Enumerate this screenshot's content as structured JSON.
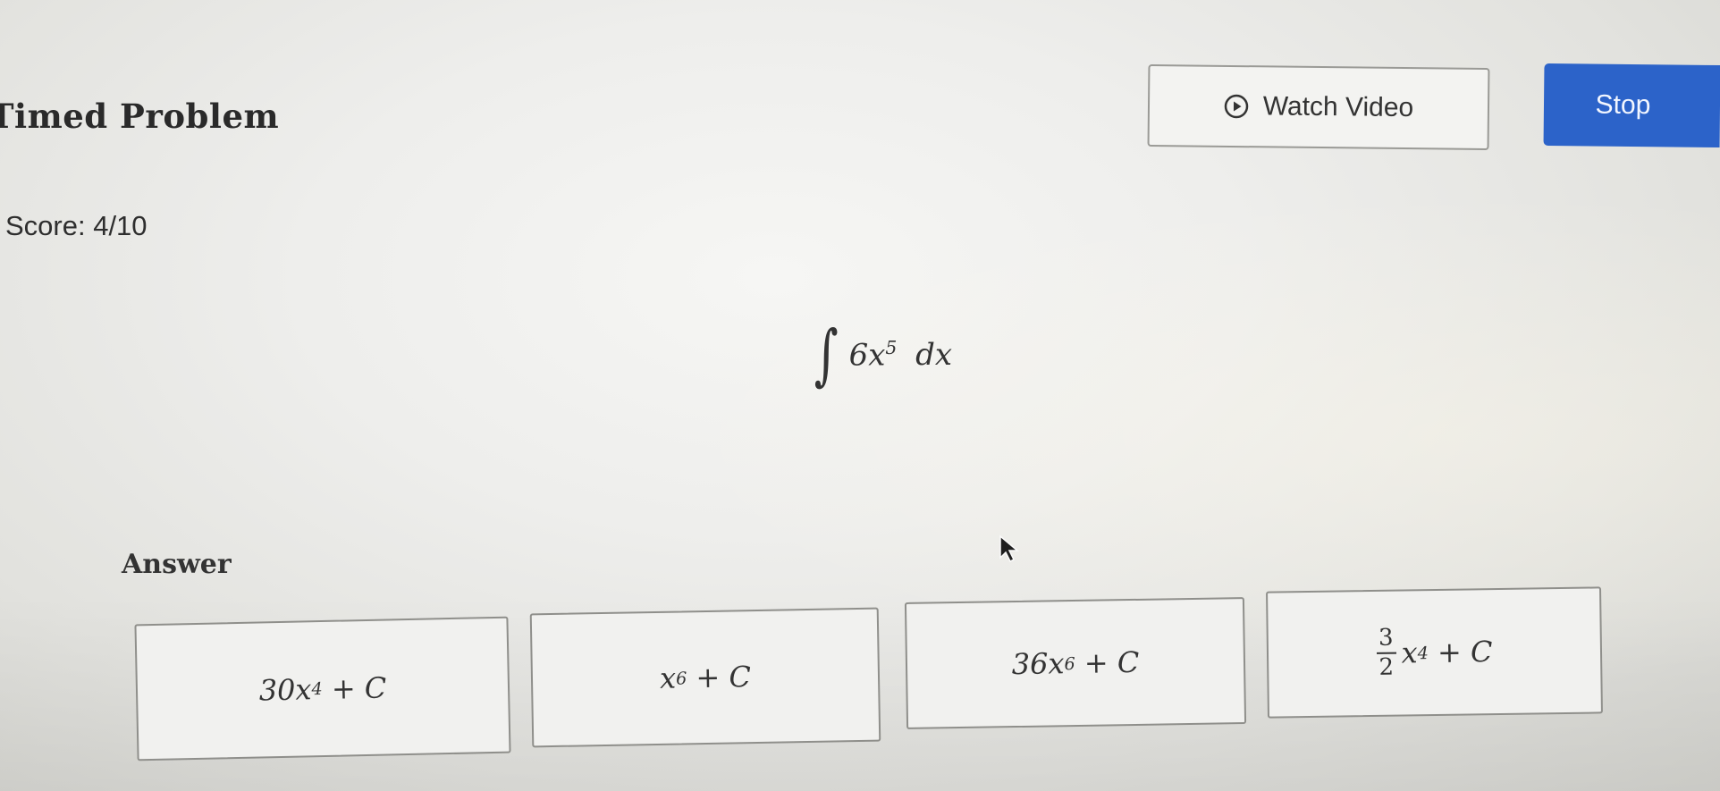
{
  "header": {
    "title": "Timed Problem",
    "watch_video_label": "Watch Video",
    "stop_label": "Stop",
    "accent_color": "#2c63c9"
  },
  "score": {
    "text": "Score: 4/10"
  },
  "problem": {
    "integral_symbol": "∫",
    "coefficient": "6x",
    "exponent": "5",
    "differential": "dx"
  },
  "answer": {
    "label": "Answer",
    "choices": [
      {
        "base": "30x",
        "exp": "4",
        "tail": " + C"
      },
      {
        "base": "x",
        "exp": "6",
        "tail": " + C"
      },
      {
        "base": "36x",
        "exp": "6",
        "tail": " + C"
      },
      {
        "frac_num": "3",
        "frac_den": "2",
        "base": "x",
        "exp": "4",
        "tail": " + C"
      }
    ]
  },
  "icons": {
    "watch_video": "play-circle-icon",
    "cursor": "mouse-pointer-icon"
  }
}
